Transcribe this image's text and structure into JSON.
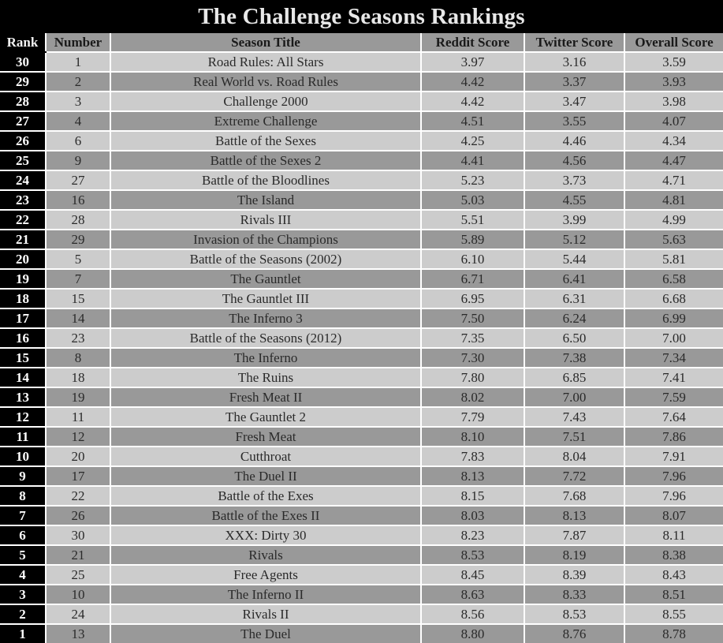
{
  "title": "The Challenge Seasons Rankings",
  "colors": {
    "background": "#000000",
    "title_text": "#e8e8e8",
    "header_bg": "#999999",
    "row_light": "#cccccc",
    "row_dark": "#999999",
    "rank_bg": "#000000",
    "rank_text": "#ffffff",
    "grid_line": "#ffffff"
  },
  "columns": [
    {
      "key": "rank",
      "label": "Rank"
    },
    {
      "key": "number",
      "label": "Number"
    },
    {
      "key": "title",
      "label": "Season Title"
    },
    {
      "key": "reddit",
      "label": "Reddit Score"
    },
    {
      "key": "twitter",
      "label": "Twitter Score"
    },
    {
      "key": "overall",
      "label": "Overall Score"
    }
  ],
  "rows": [
    {
      "rank": "30",
      "number": "1",
      "title": "Road Rules: All Stars",
      "reddit": "3.97",
      "twitter": "3.16",
      "overall": "3.59"
    },
    {
      "rank": "29",
      "number": "2",
      "title": "Real World vs. Road Rules",
      "reddit": "4.42",
      "twitter": "3.37",
      "overall": "3.93"
    },
    {
      "rank": "28",
      "number": "3",
      "title": "Challenge 2000",
      "reddit": "4.42",
      "twitter": "3.47",
      "overall": "3.98"
    },
    {
      "rank": "27",
      "number": "4",
      "title": "Extreme Challenge",
      "reddit": "4.51",
      "twitter": "3.55",
      "overall": "4.07"
    },
    {
      "rank": "26",
      "number": "6",
      "title": "Battle of the Sexes",
      "reddit": "4.25",
      "twitter": "4.46",
      "overall": "4.34"
    },
    {
      "rank": "25",
      "number": "9",
      "title": "Battle of the Sexes 2",
      "reddit": "4.41",
      "twitter": "4.56",
      "overall": "4.47"
    },
    {
      "rank": "24",
      "number": "27",
      "title": "Battle of the Bloodlines",
      "reddit": "5.23",
      "twitter": "3.73",
      "overall": "4.71"
    },
    {
      "rank": "23",
      "number": "16",
      "title": "The Island",
      "reddit": "5.03",
      "twitter": "4.55",
      "overall": "4.81"
    },
    {
      "rank": "22",
      "number": "28",
      "title": "Rivals III",
      "reddit": "5.51",
      "twitter": "3.99",
      "overall": "4.99"
    },
    {
      "rank": "21",
      "number": "29",
      "title": "Invasion of the Champions",
      "reddit": "5.89",
      "twitter": "5.12",
      "overall": "5.63"
    },
    {
      "rank": "20",
      "number": "5",
      "title": "Battle of the Seasons (2002)",
      "reddit": "6.10",
      "twitter": "5.44",
      "overall": "5.81"
    },
    {
      "rank": "19",
      "number": "7",
      "title": "The Gauntlet",
      "reddit": "6.71",
      "twitter": "6.41",
      "overall": "6.58"
    },
    {
      "rank": "18",
      "number": "15",
      "title": "The Gauntlet III",
      "reddit": "6.95",
      "twitter": "6.31",
      "overall": "6.68"
    },
    {
      "rank": "17",
      "number": "14",
      "title": "The Inferno 3",
      "reddit": "7.50",
      "twitter": "6.24",
      "overall": "6.99"
    },
    {
      "rank": "16",
      "number": "23",
      "title": "Battle of the Seasons (2012)",
      "reddit": "7.35",
      "twitter": "6.50",
      "overall": "7.00"
    },
    {
      "rank": "15",
      "number": "8",
      "title": "The Inferno",
      "reddit": "7.30",
      "twitter": "7.38",
      "overall": "7.34"
    },
    {
      "rank": "14",
      "number": "18",
      "title": "The Ruins",
      "reddit": "7.80",
      "twitter": "6.85",
      "overall": "7.41"
    },
    {
      "rank": "13",
      "number": "19",
      "title": "Fresh Meat II",
      "reddit": "8.02",
      "twitter": "7.00",
      "overall": "7.59"
    },
    {
      "rank": "12",
      "number": "11",
      "title": "The Gauntlet 2",
      "reddit": "7.79",
      "twitter": "7.43",
      "overall": "7.64"
    },
    {
      "rank": "11",
      "number": "12",
      "title": "Fresh Meat",
      "reddit": "8.10",
      "twitter": "7.51",
      "overall": "7.86"
    },
    {
      "rank": "10",
      "number": "20",
      "title": "Cutthroat",
      "reddit": "7.83",
      "twitter": "8.04",
      "overall": "7.91"
    },
    {
      "rank": "9",
      "number": "17",
      "title": "The Duel II",
      "reddit": "8.13",
      "twitter": "7.72",
      "overall": "7.96"
    },
    {
      "rank": "8",
      "number": "22",
      "title": "Battle of the Exes",
      "reddit": "8.15",
      "twitter": "7.68",
      "overall": "7.96"
    },
    {
      "rank": "7",
      "number": "26",
      "title": "Battle of the Exes II",
      "reddit": "8.03",
      "twitter": "8.13",
      "overall": "8.07"
    },
    {
      "rank": "6",
      "number": "30",
      "title": "XXX: Dirty 30",
      "reddit": "8.23",
      "twitter": "7.87",
      "overall": "8.11"
    },
    {
      "rank": "5",
      "number": "21",
      "title": "Rivals",
      "reddit": "8.53",
      "twitter": "8.19",
      "overall": "8.38"
    },
    {
      "rank": "4",
      "number": "25",
      "title": "Free Agents",
      "reddit": "8.45",
      "twitter": "8.39",
      "overall": "8.43"
    },
    {
      "rank": "3",
      "number": "10",
      "title": "The Inferno II",
      "reddit": "8.63",
      "twitter": "8.33",
      "overall": "8.51"
    },
    {
      "rank": "2",
      "number": "24",
      "title": "Rivals II",
      "reddit": "8.56",
      "twitter": "8.53",
      "overall": "8.55"
    },
    {
      "rank": "1",
      "number": "13",
      "title": "The Duel",
      "reddit": "8.80",
      "twitter": "8.76",
      "overall": "8.78"
    }
  ]
}
